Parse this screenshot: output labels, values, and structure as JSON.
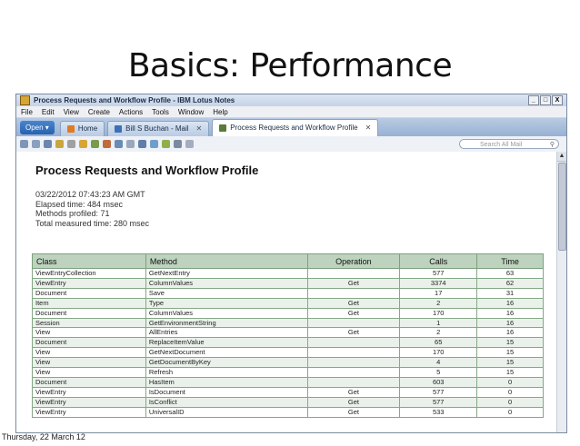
{
  "slide": {
    "title": "Basics: Performance",
    "footer": "Thursday, 22 March 12"
  },
  "window": {
    "title": "Process Requests and Workflow Profile - IBM Lotus Notes",
    "controls": [
      "_",
      "□",
      "X"
    ],
    "menu": [
      "File",
      "Edit",
      "View",
      "Create",
      "Actions",
      "Tools",
      "Window",
      "Help"
    ],
    "open_button": "Open ▾",
    "tabs": [
      {
        "label": "Home",
        "icon": "home-icon",
        "color": "#e07b22"
      },
      {
        "label": "Bill S Buchan - Mail",
        "icon": "mail-icon",
        "color": "#3b6fb6"
      },
      {
        "label": "Process Requests and Workflow Profile",
        "icon": "profile-icon",
        "color": "#5a7a3a",
        "active": true
      }
    ],
    "search_placeholder": "Search All Mail"
  },
  "document": {
    "heading": "Process Requests and Workflow Profile",
    "meta": [
      "03/22/2012 07:43:23 AM GMT",
      "Elapsed time: 484 msec",
      "Methods profiled: 71",
      "Total measured time: 280 msec"
    ],
    "table": {
      "headers": [
        "Class",
        "Method",
        "Operation",
        "Calls",
        "Time"
      ],
      "rows": [
        [
          "ViewEntryCollection",
          "GetNextEntry",
          "",
          "577",
          "63"
        ],
        [
          "ViewEntry",
          "ColumnValues",
          "Get",
          "3374",
          "62"
        ],
        [
          "Document",
          "Save",
          "",
          "17",
          "31"
        ],
        [
          "Item",
          "Type",
          "Get",
          "2",
          "16"
        ],
        [
          "Document",
          "ColumnValues",
          "Get",
          "170",
          "16"
        ],
        [
          "Session",
          "GetEnvironmentString",
          "",
          "1",
          "16"
        ],
        [
          "View",
          "AllEntries",
          "Get",
          "2",
          "16"
        ],
        [
          "Document",
          "ReplaceItemValue",
          "",
          "65",
          "15"
        ],
        [
          "View",
          "GetNextDocument",
          "",
          "170",
          "15"
        ],
        [
          "View",
          "GetDocumentByKey",
          "",
          "4",
          "15"
        ],
        [
          "View",
          "Refresh",
          "",
          "5",
          "15"
        ],
        [
          "Document",
          "HasItem",
          "",
          "603",
          "0"
        ],
        [
          "ViewEntry",
          "IsDocument",
          "Get",
          "577",
          "0"
        ],
        [
          "ViewEntry",
          "IsConflict",
          "Get",
          "577",
          "0"
        ],
        [
          "ViewEntry",
          "UniversalID",
          "Get",
          "533",
          "0"
        ]
      ]
    }
  }
}
